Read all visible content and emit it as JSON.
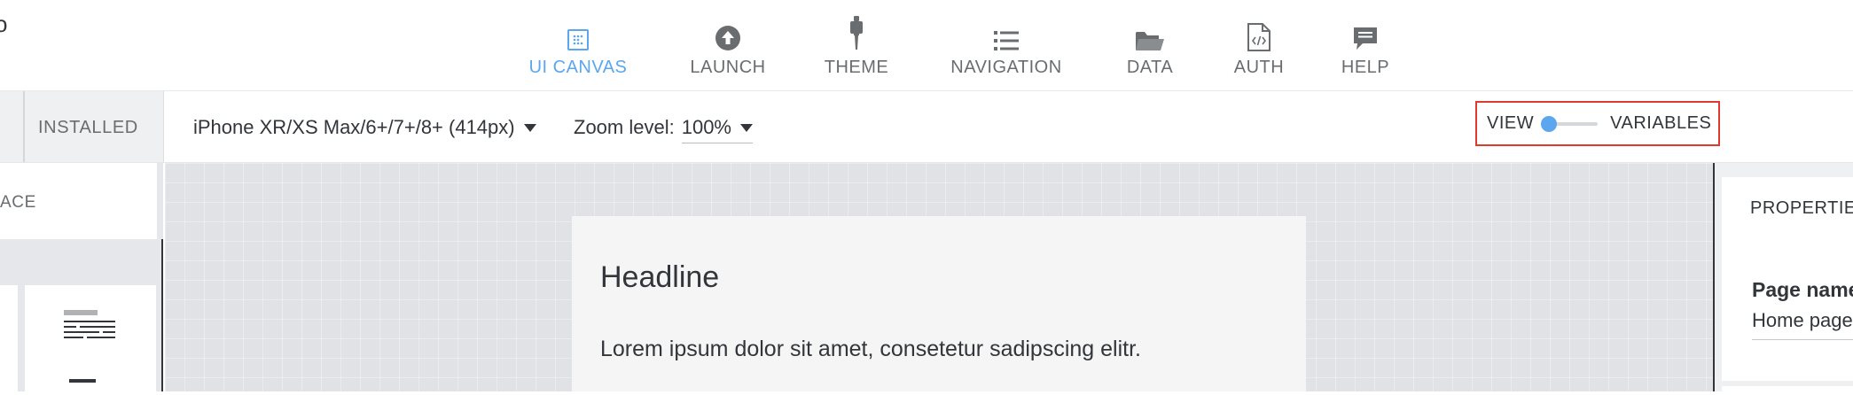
{
  "header": {
    "logo_fragment": "o",
    "nav": [
      {
        "label": "UI CANVAS",
        "icon": "ui-canvas-icon",
        "active": true
      },
      {
        "label": "LAUNCH",
        "icon": "launch-icon",
        "active": false
      },
      {
        "label": "THEME",
        "icon": "theme-icon",
        "active": false
      },
      {
        "label": "NAVIGATION",
        "icon": "navigation-icon",
        "active": false
      },
      {
        "label": "DATA",
        "icon": "data-icon",
        "active": false
      },
      {
        "label": "AUTH",
        "icon": "auth-icon",
        "active": false
      },
      {
        "label": "HELP",
        "icon": "help-icon",
        "active": false
      }
    ]
  },
  "toolbar": {
    "installed_tab": "INSTALLED",
    "device": "iPhone XR/XS Max/6+/7+/8+ (414px)",
    "zoom_label": "Zoom level:",
    "zoom_value": "100%",
    "toggle": {
      "left_label": "VIEW",
      "right_label": "VARIABLES",
      "state": "view"
    }
  },
  "left_panel": {
    "search_label": "ACE",
    "component_icon": "text-paragraph-icon"
  },
  "canvas": {
    "headline": "Headline",
    "body_text": "Lorem ipsum dolor sit amet, consetetur sadipscing elitr."
  },
  "right_panel": {
    "title": "PROPERTIES",
    "page_name_label": "Page name",
    "page_name_value": "Home page"
  },
  "colors": {
    "accent": "#5ba6ee",
    "highlight_border": "#e03a2c",
    "canvas_bg": "#e1e2e6",
    "text": "#32363a",
    "muted_text": "#6a6d70"
  }
}
